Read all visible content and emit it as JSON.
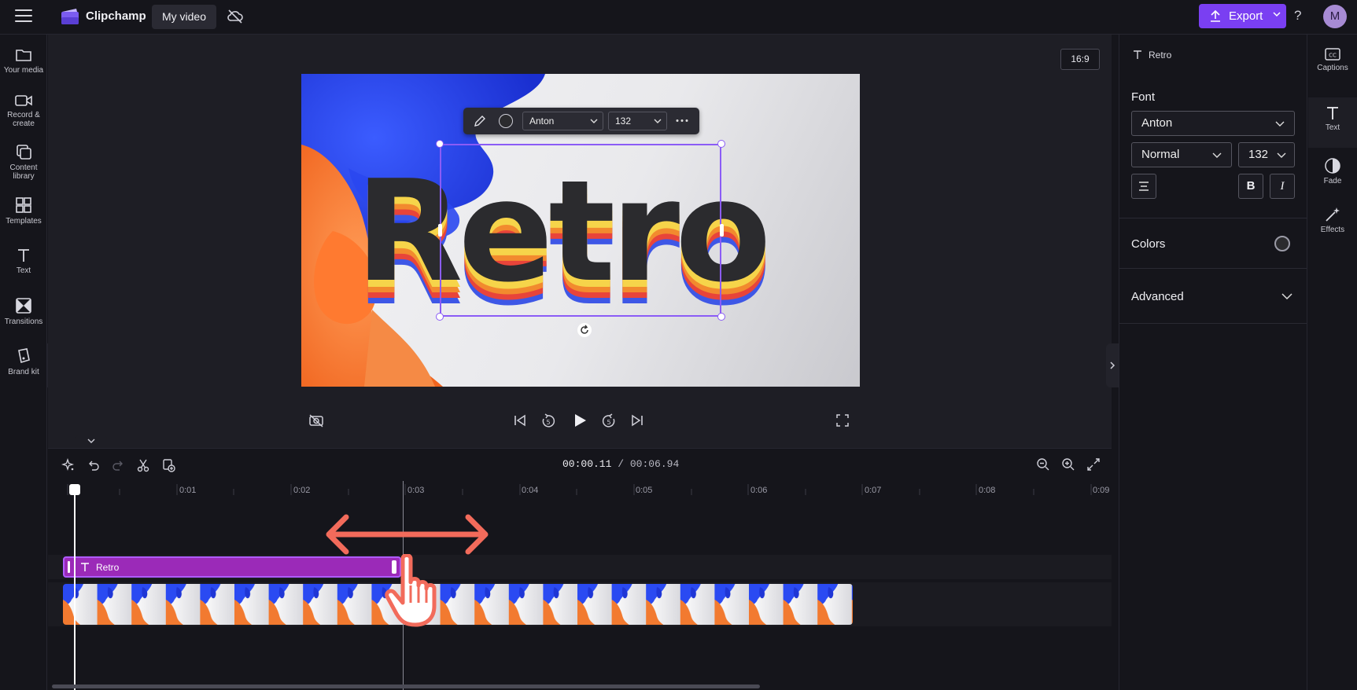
{
  "app": {
    "name": "Clipchamp",
    "project_title": "My video"
  },
  "toolbar": {
    "export_label": "Export",
    "help_label": "?",
    "avatar_initial": "M"
  },
  "leftnav": {
    "items": [
      {
        "label1": "Your media",
        "label2": ""
      },
      {
        "label1": "Record &",
        "label2": "create"
      },
      {
        "label1": "Content",
        "label2": "library"
      },
      {
        "label1": "Templates",
        "label2": ""
      },
      {
        "label1": "Text",
        "label2": ""
      },
      {
        "label1": "Transitions",
        "label2": ""
      },
      {
        "label1": "Brand kit",
        "label2": ""
      }
    ]
  },
  "preview": {
    "aspect_ratio": "16:9",
    "overlay_text": "Retro",
    "floating_toolbar": {
      "font": "Anton",
      "size": "132"
    }
  },
  "timeline": {
    "current_time": "00:00.11",
    "total_time": "/ 00:06.94",
    "ruler_labels": [
      "0:01",
      "0:02",
      "0:03",
      "0:04",
      "0:05",
      "0:06",
      "0:07",
      "0:08",
      "0:09"
    ],
    "text_clip_label": "Retro"
  },
  "properties": {
    "title": "Retro",
    "font_heading": "Font",
    "font_value": "Anton",
    "weight_value": "Normal",
    "size_value": "132",
    "bold_label": "B",
    "italic_label": "I",
    "colors_heading": "Colors",
    "advanced_heading": "Advanced",
    "text_color": "#2b2b2e"
  },
  "right_tabs": [
    {
      "label": "Captions"
    },
    {
      "label": "Text"
    },
    {
      "label": "Fade"
    },
    {
      "label": "Effects"
    }
  ],
  "colors": {
    "accent": "#7a3ff2",
    "selection": "#8b5cf6",
    "text_clip": "#9b2ab8",
    "arrow": "#f26b5b"
  }
}
